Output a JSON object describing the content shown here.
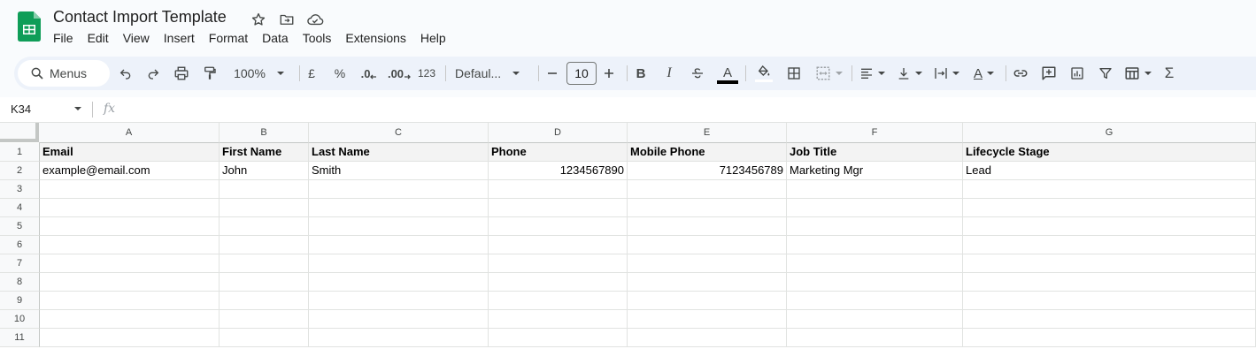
{
  "app": {
    "title": "Contact Import Template",
    "brand_color": "#0f9d58"
  },
  "title_icons": [
    "star-icon",
    "move-to-folder-icon",
    "cloud-saved-icon"
  ],
  "menu": [
    "File",
    "Edit",
    "View",
    "Insert",
    "Format",
    "Data",
    "Tools",
    "Extensions",
    "Help"
  ],
  "toolbar": {
    "search_label": "Menus",
    "zoom": "100%",
    "currency": "£",
    "percent": "%",
    "decrease_decimal": ".0",
    "increase_decimal": ".00",
    "number_format": "123",
    "font": "Defaul...",
    "font_size": "10",
    "bold": "B",
    "italic": "I",
    "text_color_glyph": "A",
    "text_rotation_glyph": "A",
    "sum_glyph": "Σ"
  },
  "formula_bar": {
    "name_box": "K34",
    "fx": "fx",
    "value": ""
  },
  "sheet": {
    "columns": [
      "A",
      "B",
      "C",
      "D",
      "E",
      "F",
      "G"
    ],
    "rows": [
      "1",
      "2",
      "3",
      "4",
      "5",
      "6",
      "7",
      "8",
      "9",
      "10",
      "11"
    ],
    "header_row": [
      "Email",
      "First Name",
      "Last Name",
      "Phone",
      "Mobile Phone",
      "Job Title",
      "Lifecycle Stage"
    ],
    "data_row": [
      "example@email.com",
      "John",
      "Smith",
      "1234567890",
      "7123456789",
      "Marketing Mgr",
      "Lead"
    ]
  }
}
